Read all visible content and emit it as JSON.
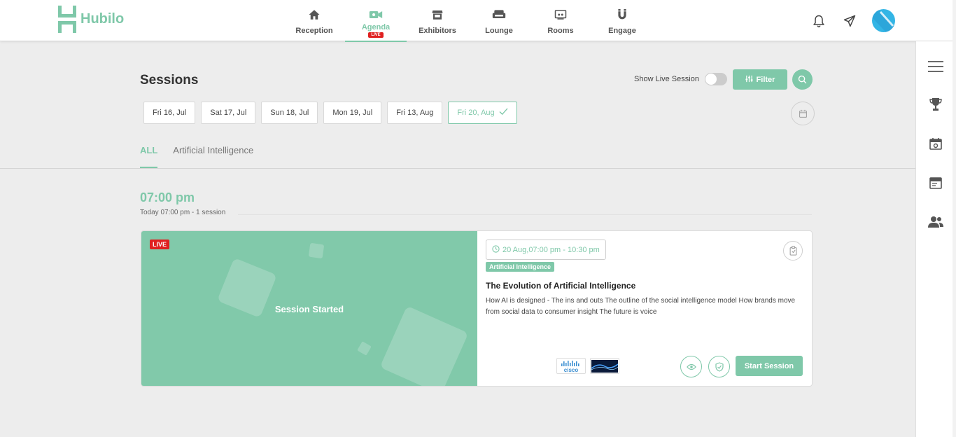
{
  "app": {
    "name": "Hubilo"
  },
  "nav": {
    "items": [
      {
        "label": "Reception",
        "icon": "home-icon"
      },
      {
        "label": "Agenda",
        "icon": "video-camera-icon",
        "badge": "LIVE",
        "active": true
      },
      {
        "label": "Exhibitors",
        "icon": "store-icon"
      },
      {
        "label": "Lounge",
        "icon": "sofa-icon"
      },
      {
        "label": "Rooms",
        "icon": "screen-icon"
      },
      {
        "label": "Engage",
        "icon": "magnet-icon"
      }
    ]
  },
  "header_icons": [
    "bell-icon",
    "paper-plane-icon",
    "avatar"
  ],
  "sidebar": {
    "items": [
      "menu-icon",
      "trophy-icon",
      "calendar-icon",
      "window-icon",
      "people-icon"
    ]
  },
  "page": {
    "title": "Sessions",
    "show_live_label": "Show Live Session",
    "show_live_on": false,
    "filter_label": "Filter"
  },
  "dates": [
    {
      "label": "Fri 16, Jul"
    },
    {
      "label": "Sat 17, Jul"
    },
    {
      "label": "Sun 18, Jul"
    },
    {
      "label": "Mon 19, Jul"
    },
    {
      "label": "Fri 13, Aug"
    },
    {
      "label": "Fri 20, Aug",
      "active": true
    }
  ],
  "tabs": [
    {
      "label": "ALL",
      "active": true
    },
    {
      "label": "Artificial Intelligence"
    }
  ],
  "time_group": {
    "time": "07:00 pm",
    "subtitle": "Today 07:00 pm - 1  session"
  },
  "session": {
    "live_tag": "LIVE",
    "status": "Session Started",
    "time_range": "20 Aug,07:00 pm - 10:30 pm",
    "track": "Artificial Intelligence",
    "title": "The Evolution of Artificial Intelligence",
    "description": "How AI is designed - The ins and outs The outline of the social intelligence model How brands move from social data to consumer insight The future is voice",
    "sponsors": [
      {
        "text": "cisco"
      },
      {
        "text": ""
      }
    ],
    "start_label": "Start Session"
  },
  "colors": {
    "accent": "#7fc8a9",
    "live": "#e02020",
    "background": "#ededed"
  }
}
